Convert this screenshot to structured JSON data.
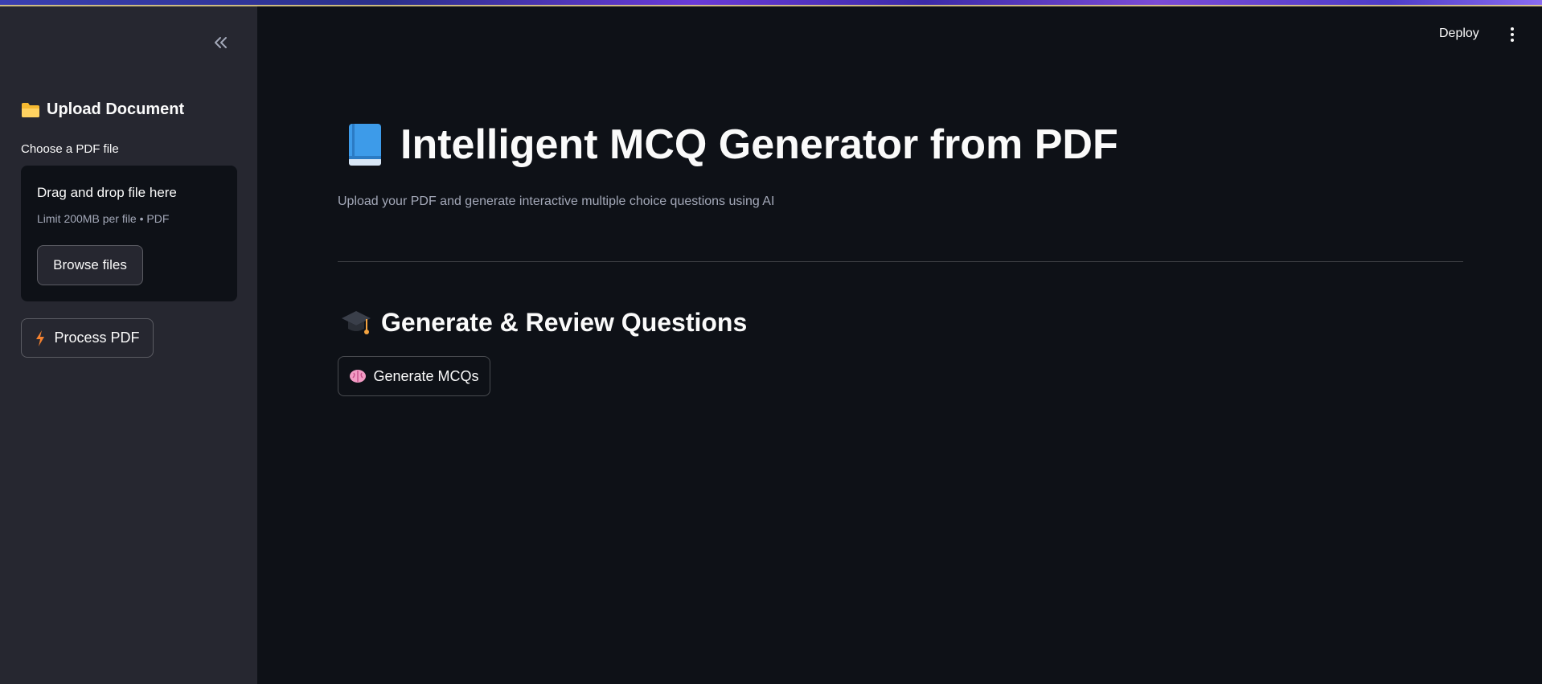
{
  "header": {
    "deploy_label": "Deploy",
    "menu_icon": "vertical-ellipsis-icon"
  },
  "sidebar": {
    "collapse_icon": "double-chevron-left-icon",
    "section_title": "Upload Document",
    "section_icon": "folder-icon",
    "file_label": "Choose a PDF file",
    "dropzone": {
      "title": "Drag and drop file here",
      "limit_text": "Limit 200MB per file • PDF",
      "browse_label": "Browse files"
    },
    "process_button": {
      "label": "Process PDF",
      "icon": "lightning-icon"
    }
  },
  "main": {
    "title": "Intelligent MCQ Generator from PDF",
    "title_icon": "blue-book-icon",
    "subtitle": "Upload your PDF and generate interactive multiple choice questions using AI",
    "section_title": "Generate & Review Questions",
    "section_icon": "graduation-cap-icon",
    "generate_button": {
      "label": "Generate MCQs",
      "icon": "brain-icon"
    }
  },
  "colors": {
    "background": "#0e1117",
    "sidebar": "#262730",
    "text": "#fafafa",
    "muted_text": "#a3a8b8"
  }
}
